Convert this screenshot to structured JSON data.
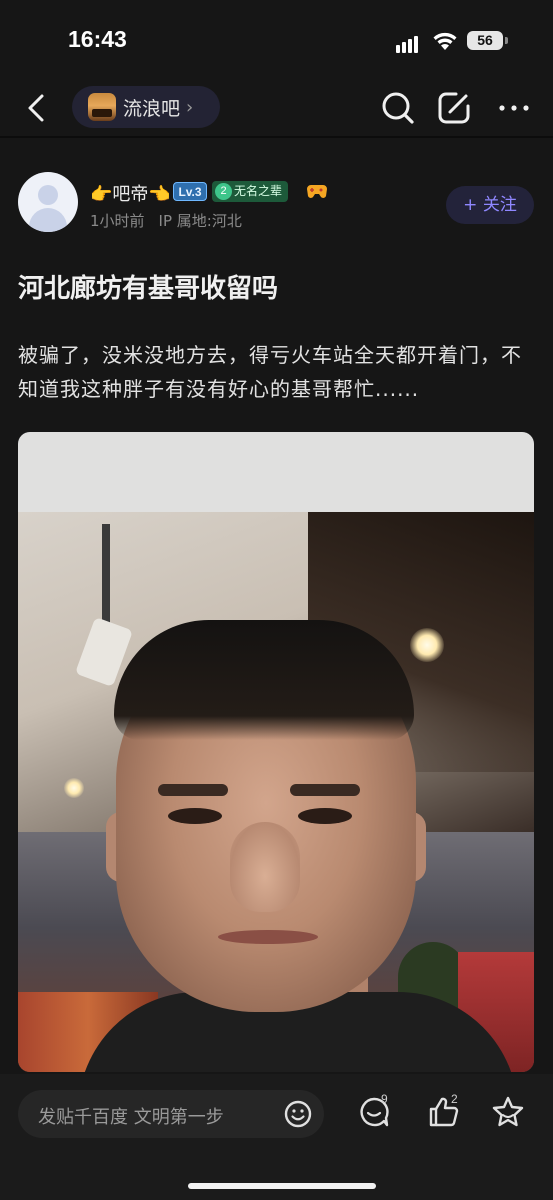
{
  "status_bar": {
    "time": "16:43",
    "battery": "56"
  },
  "nav": {
    "forum_name": "流浪吧",
    "forum_chevron": "›",
    "icons": [
      "back-icon",
      "search-icon",
      "edit-icon",
      "more-icon"
    ]
  },
  "author": {
    "name": "👉吧帝👈",
    "level": "Lv.3",
    "title_badge_num": "2",
    "title_badge_text": "无名之辈",
    "time_ago": "1小时前",
    "ip_location": "IP 属地:河北",
    "follow_label": "+ 关注"
  },
  "post": {
    "title": "河北廊坊有基哥收留吗",
    "body": "被骗了，没米没地方去，得亏火车站全天都开着门，不知道我这种胖子有没有好心的基哥帮忙......"
  },
  "bottom": {
    "input_placeholder": "发贴千百度 文明第一步",
    "comment_count": "9",
    "like_count": "2"
  },
  "colors": {
    "accent": "#8f87ff",
    "background": "#161616",
    "level_badge": "#2f6fae",
    "title_badge": "#1d5a3a"
  }
}
